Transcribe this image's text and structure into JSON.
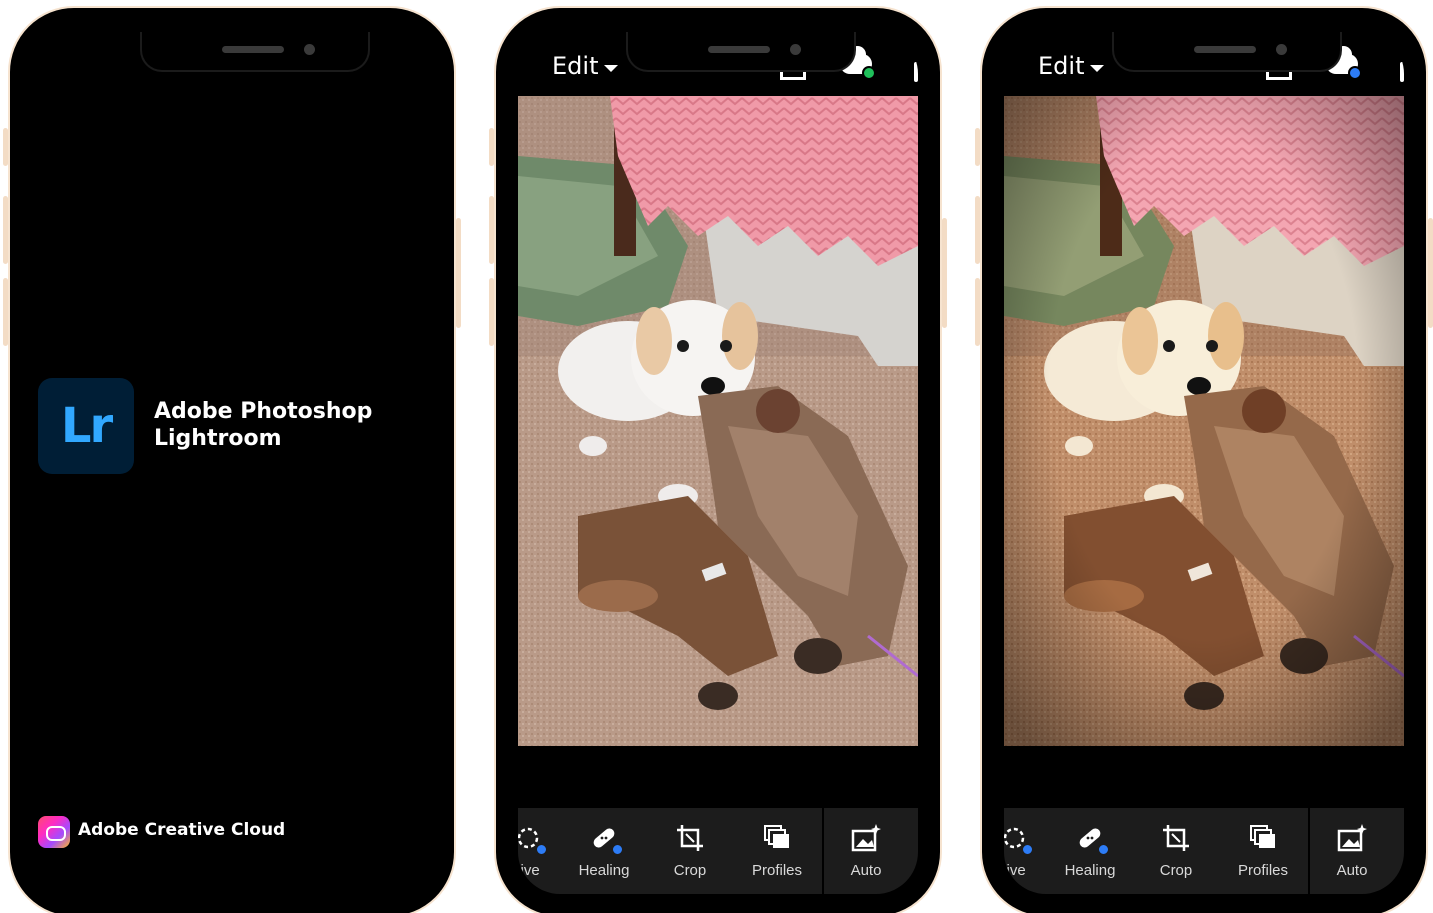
{
  "splash": {
    "logo_text": "Lr",
    "app_name_line1": "Adobe Photoshop",
    "app_name_line2": "Lightroom",
    "footer_brand": "Adobe Creative Cloud"
  },
  "edit_before": {
    "title": "Edit",
    "cloud_status_color": "#1fbf5a",
    "tools": [
      {
        "label": "tive",
        "icon": "selective-icon"
      },
      {
        "label": "Healing",
        "icon": "healing-bandage-icon"
      },
      {
        "label": "Crop",
        "icon": "crop-icon"
      },
      {
        "label": "Profiles",
        "icon": "profiles-icon"
      },
      {
        "label": "Auto",
        "icon": "auto-enhance-icon"
      }
    ]
  },
  "edit_after": {
    "title": "Edit",
    "cloud_status_color": "#2d7cf6",
    "tools": [
      {
        "label": "tive",
        "icon": "selective-icon"
      },
      {
        "label": "Healing",
        "icon": "healing-bandage-icon"
      },
      {
        "label": "Crop",
        "icon": "crop-icon"
      },
      {
        "label": "Profiles",
        "icon": "profiles-icon"
      },
      {
        "label": "Auto",
        "icon": "auto-enhance-icon"
      }
    ]
  },
  "colors": {
    "lr_brand_dark": "#001e36",
    "lr_brand_blue": "#31a8ff",
    "phone_frame": "#f6e3cf"
  }
}
